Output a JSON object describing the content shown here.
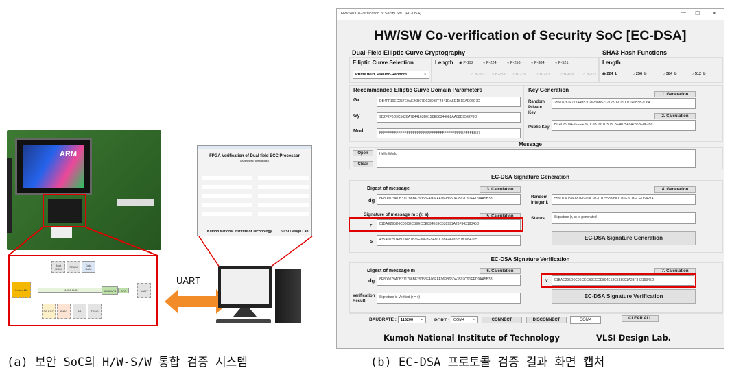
{
  "left_panel": {
    "board_lcd_text": "ARM",
    "block_diagram": {
      "cpu": "Cortex-M0",
      "bus": "AMBA AHB",
      "bridge": "AHB2APB",
      "apb": "APB",
      "uart": "UART",
      "memories": [
        "Boot ROM",
        "SRAM",
        "Data RAM"
      ],
      "peripherals": [
        "DF-ECC",
        "SHA3",
        "AA",
        "TRNG"
      ]
    },
    "link_label": "UART",
    "mini_screen": {
      "title": "FPGA Verification of Dual field ECC Processor",
      "subtitle": "[ Arithmetic operations ]",
      "footer_left": "Kumoh National Institute of Technology",
      "footer_right": "VLSI Design Lab."
    }
  },
  "window": {
    "title_bar": "HW/SW Co-verification of Seciry SoC [EC-DSA]",
    "controls": {
      "minimize": "—",
      "maximize": "☐",
      "close": "✕"
    },
    "heading": "HW/SW Co-verification of Security SoC [EC-DSA]",
    "ecc": {
      "section_title": "Dual-Field Elliptic Curve Cryptography",
      "curve_selection_label": "Elliptic Curve Selection",
      "curve_selected": "Prime field, Pseudo-Random1",
      "length_label": "Length",
      "prime_lengths": [
        "P-192",
        "P-224",
        "P-256",
        "P-384",
        "P-521"
      ],
      "prime_selected": "P-192",
      "binary_lengths": [
        "B-163",
        "B-233",
        "B-239",
        "B-283",
        "B-409",
        "B-571"
      ]
    },
    "sha3": {
      "section_title": "SHA3 Hash Functions",
      "length_label": "Length",
      "options": [
        "224_b",
        "256_b",
        "384_b",
        "512_b"
      ],
      "selected": "224_b"
    },
    "domain_params": {
      "title": "Recommended Elliptic Curve Domain Parameters",
      "gx_label": "Gx",
      "gx": "DB4FF10EC057E9AE26B07D0280B7F4341DA5D1B1EAE06C7D",
      "gy_label": "Gy",
      "gy": "9B2F2F6D9C5628A7844163D015BE86344082AA88D95E2F9D",
      "mod_label": "Mod",
      "mod": "FFFFFFFFFFFFFFFFFFFFFFFFFFFFFFFFFFFFFFFEFFFFEE37"
    },
    "key_gen": {
      "title": "Key Generation",
      "gen_button": "1. Generation",
      "private_label": "Random Private Key",
      "private_key": "25618281F77744B53026238B5237128D9D7D071F6B5B2D64",
      "calc_button": "2. Calculation",
      "public_label": "Public Key",
      "public_key": "BC4D8979E9FEEE761C5B7667C503C5FA025F94785BF067B9"
    },
    "message": {
      "title": "Message",
      "open_button": "Open",
      "clear_button": "Clear",
      "value": "Hello World"
    },
    "sig_gen": {
      "title": "EC-DSA Signature Generation",
      "digest_label": "Digest of message",
      "calc3_button": "3. Calculation",
      "dg_label": "dg",
      "dg": "8E800079A0B311788BF29353F400EFF969B650A3597C91EFD9AA5B38",
      "random_k_label": "Random integer k",
      "gen4_button": "4. Generation",
      "random_k": "555D7A059E881F6969C93201C553389DCB6E5CBFCED6A214",
      "signature_label": "Signature of message m : (r, s)",
      "calc5_button": "5. Calculation",
      "r_label": "r",
      "r": "01BAE295D6C06CECB9ECDE894E53C538991A28F34319345D",
      "s_label": "s",
      "s": "435A00291E8CDA87876E88EBE548CC5BE4FD095180854165",
      "status_label": "Status",
      "status": "Signature (r, s) is generated",
      "action_button": "EC-DSA Signature Generation"
    },
    "sig_ver": {
      "title": "EC-DSA Signature Verification",
      "digest_label": "Digest of message m",
      "calc6_button": "6. Calculation",
      "dg_label": "dg",
      "dg": "8E800079A0B311788BF29353F400EFF969B650A3597C91EFD9AA5B38",
      "calc7_button": "7. Calculation",
      "v_label": "v",
      "v": "01BAE295D6C06CECB9ECDE894E53C538991A28F34319345D",
      "result_label": "Verification Result",
      "result": "Signature is Verified (r = v)",
      "action_button": "EC-DSA Signature Verification"
    },
    "serial": {
      "baudrate_label": "BAUDRATE :",
      "baudrate": "115200",
      "port_label": "PORT :",
      "port": "COM4",
      "connect_button": "CONNECT",
      "disconnect_button": "DISCONNECT",
      "connected_port": "COM4",
      "clear_all_button": "CLEAR ALL"
    },
    "footer_left": "Kumoh National Institute of Technology",
    "footer_right": "VLSI Design Lab."
  },
  "captions": {
    "a": "(a) 보안 SoC의 H/W-S/W 통합 검증 시스템",
    "b": "(b) EC-DSA 프로토콜 검증 결과 화면 캡처"
  },
  "colors": {
    "highlight": "#e00000",
    "arrow": "#f28c28",
    "pcb": "#2f6b2a"
  }
}
